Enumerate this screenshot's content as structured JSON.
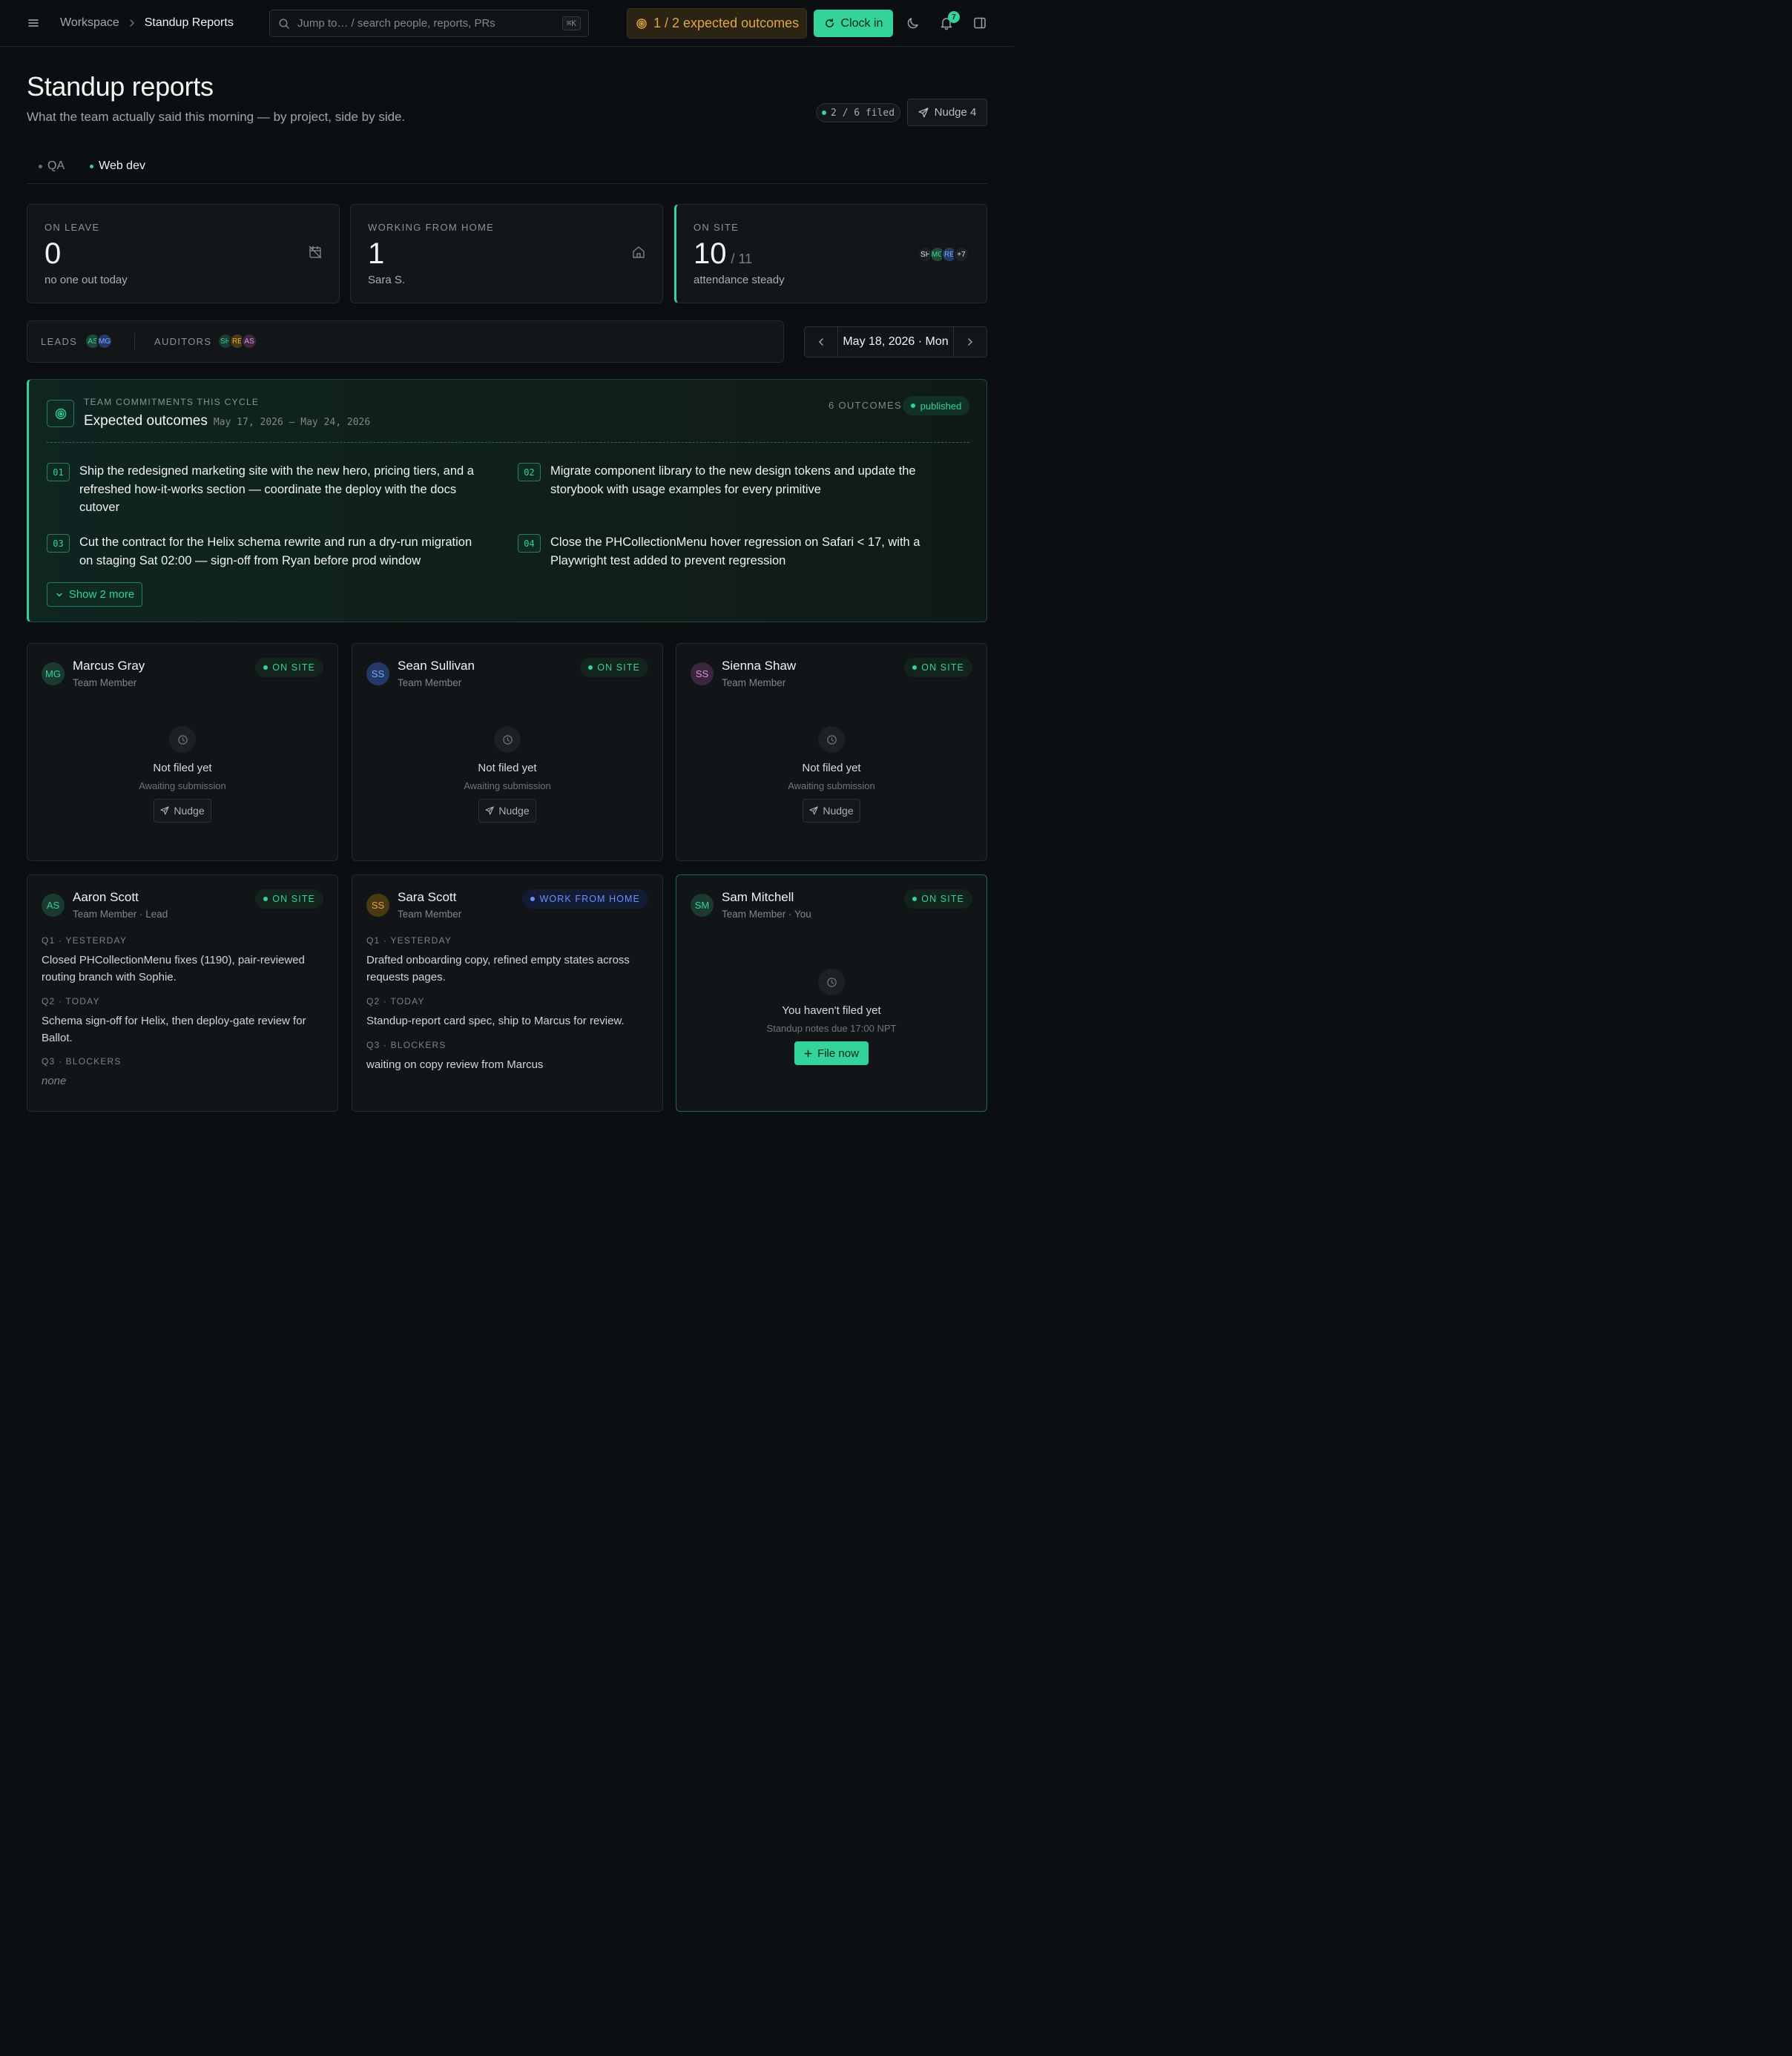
{
  "topbar": {
    "breadcrumb": [
      "Workspace",
      "Standup Reports"
    ],
    "search_placeholder": "Jump to… / search people, reports, PRs",
    "search_shortcut": "⌘K",
    "outcomes_pill": "1 / 2 expected outcomes",
    "clock_in_label": "Clock in",
    "notifications_count": "7"
  },
  "header": {
    "title": "Standup reports",
    "subtitle": "What the team actually said this morning — by project, side by side.",
    "filed_status": "2 / 6 filed",
    "nudge_all_label": "Nudge 4"
  },
  "tabs": [
    {
      "label": "QA",
      "active": false
    },
    {
      "label": "Web dev",
      "active": true
    }
  ],
  "stats": [
    {
      "label": "ON LEAVE",
      "value": "0",
      "total": "",
      "sub": "no one out today",
      "icon": "calendar-off-icon"
    },
    {
      "label": "WORKING FROM HOME",
      "value": "1",
      "total": "",
      "sub": "Sara S.",
      "icon": "home-icon"
    },
    {
      "label": "ON SITE",
      "value": "10",
      "total": "/ 11",
      "sub": "attendance steady",
      "avatars": [
        "SH",
        "MG",
        "RE"
      ],
      "more": "+7"
    }
  ],
  "roles": {
    "leads_label": "LEADS",
    "leads": [
      {
        "initials": "AS",
        "bg": "#1f4a38",
        "fg": "#34d399"
      },
      {
        "initials": "MG",
        "bg": "#233a66",
        "fg": "#7fa3ff"
      }
    ],
    "auditors_label": "AUDITORS",
    "auditors": [
      {
        "initials": "SH",
        "bg": "#1c3a2f",
        "fg": "#34d399"
      },
      {
        "initials": "RE",
        "bg": "#4a3a14",
        "fg": "#e2a544"
      },
      {
        "initials": "AS",
        "bg": "#3d2440",
        "fg": "#d19ad8"
      }
    ]
  },
  "date_nav": {
    "date": "May 18, 2026 · Mon"
  },
  "outcomes": {
    "kicker": "TEAM COMMITMENTS THIS CYCLE",
    "title": "Expected outcomes",
    "range": "May 17, 2026 — May 24, 2026",
    "count": "6 OUTCOMES",
    "status": "published",
    "items": [
      {
        "num": "01",
        "text": "Ship the redesigned marketing site with the new hero, pricing tiers, and a refreshed how-it-works section — coordinate the deploy with the docs cutover"
      },
      {
        "num": "02",
        "text": "Migrate component library to the new design tokens and update the storybook with usage examples for every primitive"
      },
      {
        "num": "03",
        "text": "Cut the contract for the Helix schema rewrite and run a dry-run migration on staging Sat 02:00 — sign-off from Ryan before prod window"
      },
      {
        "num": "04",
        "text": "Close the PHCollectionMenu hover regression on Safari < 17, with a Playwright test added to prevent regression"
      }
    ],
    "show_more": "Show 2 more"
  },
  "members": [
    {
      "initials": "MG",
      "name": "Marcus Gray",
      "role": "Team Member",
      "status": "ON SITE",
      "status_kind": "onsite",
      "av_bg": "#1c3a2f",
      "av_fg": "#34d399",
      "empty": {
        "title": "Not filed yet",
        "sub": "Awaiting submission",
        "action": "Nudge"
      }
    },
    {
      "initials": "SS",
      "name": "Sean Sullivan",
      "role": "Team Member",
      "status": "ON SITE",
      "status_kind": "onsite",
      "av_bg": "#233a66",
      "av_fg": "#7fa3ff",
      "empty": {
        "title": "Not filed yet",
        "sub": "Awaiting submission",
        "action": "Nudge"
      }
    },
    {
      "initials": "SS",
      "name": "Sienna Shaw",
      "role": "Team Member",
      "status": "ON SITE",
      "status_kind": "onsite",
      "av_bg": "#3d2440",
      "av_fg": "#d19ad8",
      "empty": {
        "title": "Not filed yet",
        "sub": "Awaiting submission",
        "action": "Nudge"
      }
    },
    {
      "initials": "AS",
      "name": "Aaron Scott",
      "role": "Team Member · Lead",
      "status": "ON SITE",
      "status_kind": "onsite",
      "av_bg": "#1c3a2f",
      "av_fg": "#34d399",
      "answers": [
        {
          "q": "Q1 · YESTERDAY",
          "a": "Closed PHCollectionMenu fixes (1190), pair-reviewed routing branch with Sophie."
        },
        {
          "q": "Q2 · TODAY",
          "a": "Schema sign-off for Helix, then deploy-gate review for Ballot."
        },
        {
          "q": "Q3 · BLOCKERS",
          "a": "none"
        }
      ]
    },
    {
      "initials": "SS",
      "name": "Sara Scott",
      "role": "Team Member",
      "status": "WORK FROM HOME",
      "status_kind": "wfh",
      "av_bg": "#4a3a14",
      "av_fg": "#e2a544",
      "answers": [
        {
          "q": "Q1 · YESTERDAY",
          "a": "Drafted onboarding copy, refined empty states across requests pages."
        },
        {
          "q": "Q2 · TODAY",
          "a": "Standup-report card spec, ship to Marcus for review."
        },
        {
          "q": "Q3 · BLOCKERS",
          "a": "waiting on copy review from Marcus"
        }
      ]
    },
    {
      "initials": "SM",
      "name": "Sam Mitchell",
      "role": "Team Member · You",
      "status": "ON SITE",
      "status_kind": "onsite",
      "av_bg": "#1c3a2f",
      "av_fg": "#34d399",
      "empty": {
        "title": "You haven't filed yet",
        "sub": "Standup notes due 17:00 NPT",
        "action": "File now"
      }
    }
  ]
}
